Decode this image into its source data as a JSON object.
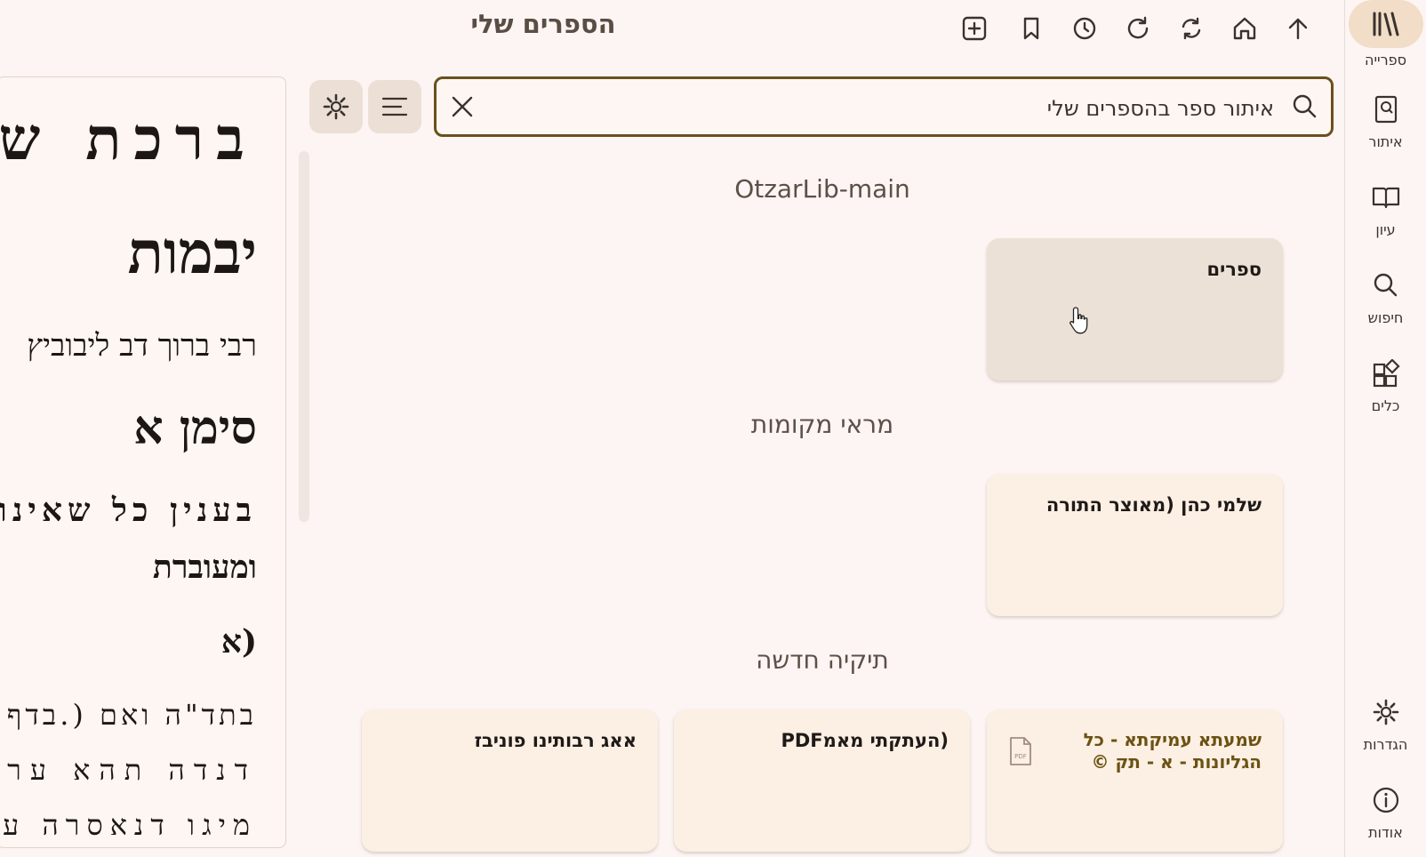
{
  "header": {
    "title": "הספרים שלי",
    "toolbar": [
      "plus-square-icon",
      "bookmark-icon",
      "history-icon",
      "refresh-icon",
      "sync-icon",
      "home-icon",
      "arrow-up-icon"
    ]
  },
  "search": {
    "placeholder": "איתור ספר בהספרים שלי",
    "value": ""
  },
  "sections": [
    {
      "title": "OtzarLib-main",
      "cards": [
        {
          "title": "ספרים"
        }
      ]
    },
    {
      "title": "מראי מקומות",
      "cards": [
        {
          "title": "שלמי כהן (מאוצר התורה"
        }
      ]
    },
    {
      "title": "תיקיה חדשה",
      "cards": [
        {
          "title": "שמעתא עמיקתא - כל הגליונות - א - תק ©",
          "icon": "pdf-file-icon"
        },
        {
          "title": "(העתקתי מאמPDF"
        },
        {
          "title": "אאג רבותינו פוניבז"
        }
      ]
    }
  ],
  "sidebar": {
    "items": [
      {
        "label": "ספרייה",
        "icon": "library-icon",
        "active": true
      },
      {
        "label": "איתור",
        "icon": "find-book-icon"
      },
      {
        "label": "עיון",
        "icon": "open-book-icon"
      },
      {
        "label": "חיפוש",
        "icon": "search-icon"
      },
      {
        "label": "כלים",
        "icon": "tools-icon"
      },
      {
        "label": "הגדרות",
        "icon": "settings-icon"
      },
      {
        "label": "אודות",
        "icon": "info-icon"
      }
    ]
  },
  "preview": {
    "lines": [
      "ברכת שמואל",
      "יבמות",
      "רבי ברוך דב ליבוביץ",
      "סימן א",
      "בענין כל שאינו עומד",
      "ומעוברת",
      "א)",
      "(בדף ב.) בתד\"ה ואם",
      "דנדה תהא ערוה",
      "מיגו דנאסרה עליו"
    ]
  },
  "colors": {
    "accent": "#6b4f1d",
    "background": "#fcf5f3",
    "card": "#fcefe4",
    "active_rail": "#f1ddc8"
  }
}
